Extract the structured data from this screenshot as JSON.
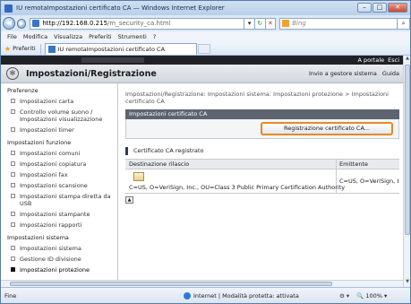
{
  "window": {
    "title": "IU remotaImpostazioni certificato CA — Windows Internet Explorer",
    "minimize": "–",
    "maximize": "□",
    "close": "✕"
  },
  "address_bar": {
    "url_host": "http://192.168.0.215",
    "url_path": "/m_security_ca.html",
    "search_placeholder": "Bing"
  },
  "menu": [
    "File",
    "Modifica",
    "Visualizza",
    "Preferiti",
    "Strumenti",
    "?"
  ],
  "favorites": {
    "label": "Preferiti",
    "tab_title": "IU remotaImpostazioni certificato CA"
  },
  "page": {
    "top_links": {
      "portal": "A portale",
      "logout": "Esci"
    },
    "title": "Impostazioni/Registrazione",
    "header_links": [
      "Invio a gestore sistema",
      "Guida"
    ],
    "breadcrumb": "Impostazioni/Registrazione: Impostazioni sistema: Impostazioni protezione > Impostazioni certificato CA",
    "section_title": "Impostazioni certificato CA",
    "register_button": "Registrazione certificato CA...",
    "sub_title": "Certificato CA registrato",
    "table": {
      "headers": [
        "Destinazione rilascio",
        "Emittente"
      ],
      "rows": [
        {
          "destination": "C=US, O=VeriSign, Inc., OU=Class 3 Public Primary Certification Authority",
          "issuer": "C=US, O=VeriSign, Inc."
        }
      ]
    }
  },
  "sidebar": {
    "groups": [
      {
        "label": "Preferenze",
        "items": [
          "Impostazioni carta",
          "Controllo volume suono / Impostazioni visualizzazione",
          "Impostazioni timer"
        ]
      },
      {
        "label": "Impostazioni funzione",
        "items": [
          "Impostazioni comuni",
          "Impostazioni copiatura",
          "Impostazioni fax",
          "Impostazioni scansione",
          "Impostazioni stampa diretta da USB",
          "Impostazioni stampante",
          "Impostazioni rapporti"
        ]
      },
      {
        "label": "Impostazioni sistema",
        "items": [
          "Impostazioni sistema",
          "Gestione ID divisione",
          "Impostazioni protezione"
        ]
      }
    ],
    "active_item": "Impostazioni protezione"
  },
  "status_bar": {
    "left": "Fine",
    "zone": "Internet | Modalità protetta: attivata",
    "zoom": "100%"
  }
}
